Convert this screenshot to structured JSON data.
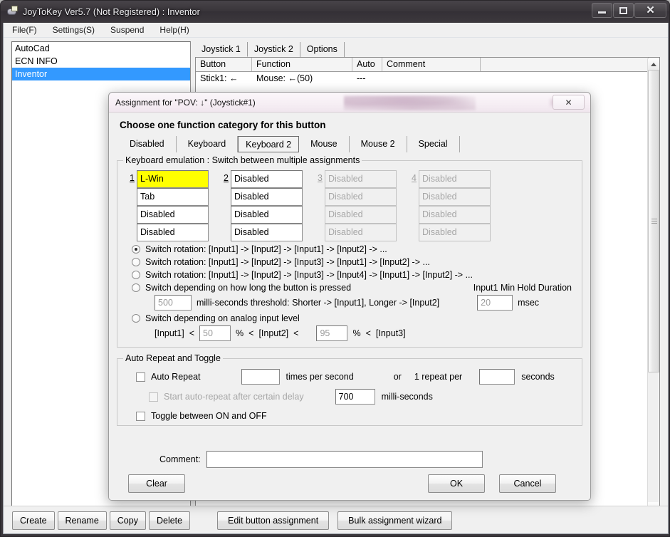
{
  "window": {
    "title": "JoyToKey Ver5.7 (Not Registered) : Inventor",
    "icon": "joystick-icon",
    "minimize_label": "Minimize",
    "maximize_label": "Maximize",
    "close_label": "✕"
  },
  "menu": {
    "items": [
      {
        "label": "File(F)"
      },
      {
        "label": "Settings(S)"
      },
      {
        "label": "Suspend"
      },
      {
        "label": "Help(H)"
      }
    ]
  },
  "profiles": {
    "items": [
      {
        "label": "AutoCad",
        "selected": false
      },
      {
        "label": "ECN INFO",
        "selected": false
      },
      {
        "label": "Inventor",
        "selected": true
      }
    ]
  },
  "tabs": [
    {
      "label": "Joystick 1",
      "active": true
    },
    {
      "label": "Joystick 2",
      "active": false
    },
    {
      "label": "Options",
      "active": false
    }
  ],
  "grid": {
    "columns": [
      "Button",
      "Function",
      "Auto",
      "Comment"
    ],
    "rows": [
      {
        "button": "Stick1: ←",
        "function": "Mouse: ←(50)",
        "auto": "---",
        "comment": ""
      }
    ]
  },
  "bottom_bar": {
    "left_buttons": [
      "Create",
      "Rename",
      "Copy",
      "Delete"
    ],
    "right_buttons": [
      "Edit button assignment",
      "Bulk assignment wizard"
    ]
  },
  "dialog": {
    "title": "Assignment for \"POV: ↓\" (Joystick#1)",
    "close_label": "✕",
    "heading": "Choose one function category for this button",
    "category_tabs": [
      {
        "label": "Disabled",
        "active": false
      },
      {
        "label": "Keyboard",
        "active": false
      },
      {
        "label": "Keyboard 2",
        "active": true
      },
      {
        "label": "Mouse",
        "active": false
      },
      {
        "label": "Mouse 2",
        "active": false
      },
      {
        "label": "Special",
        "active": false
      }
    ],
    "keyboard_group": {
      "legend": "Keyboard emulation : Switch between multiple assignments",
      "columns": [
        {
          "number": "1",
          "enabled": true,
          "fields": [
            {
              "value": "L-Win",
              "highlight": true,
              "enabled": true
            },
            {
              "value": "Tab",
              "highlight": false,
              "enabled": true
            },
            {
              "value": "Disabled",
              "highlight": false,
              "enabled": true
            },
            {
              "value": "Disabled",
              "highlight": false,
              "enabled": true
            }
          ]
        },
        {
          "number": "2",
          "enabled": true,
          "fields": [
            {
              "value": "Disabled",
              "highlight": false,
              "enabled": true
            },
            {
              "value": "Disabled",
              "highlight": false,
              "enabled": true
            },
            {
              "value": "Disabled",
              "highlight": false,
              "enabled": true
            },
            {
              "value": "Disabled",
              "highlight": false,
              "enabled": true
            }
          ]
        },
        {
          "number": "3",
          "enabled": false,
          "fields": [
            {
              "value": "Disabled",
              "highlight": false,
              "enabled": false
            },
            {
              "value": "Disabled",
              "highlight": false,
              "enabled": false
            },
            {
              "value": "Disabled",
              "highlight": false,
              "enabled": false
            },
            {
              "value": "Disabled",
              "highlight": false,
              "enabled": false
            }
          ]
        },
        {
          "number": "4",
          "enabled": false,
          "fields": [
            {
              "value": "Disabled",
              "highlight": false,
              "enabled": false
            },
            {
              "value": "Disabled",
              "highlight": false,
              "enabled": false
            },
            {
              "value": "Disabled",
              "highlight": false,
              "enabled": false
            },
            {
              "value": "Disabled",
              "highlight": false,
              "enabled": false
            }
          ]
        }
      ],
      "radios": [
        {
          "label": "Switch rotation: [Input1] -> [Input2] -> [Input1] -> [Input2] -> ...",
          "checked": true
        },
        {
          "label": "Switch rotation: [Input1] -> [Input2] -> [Input3] -> [Input1] -> [Input2] -> ...",
          "checked": false
        },
        {
          "label": "Switch rotation: [Input1] -> [Input2] -> [Input3] -> [Input4] -> [Input1] -> [Input2] -> ...",
          "checked": false
        },
        {
          "label": "Switch depending on how long the button is pressed",
          "checked": false
        },
        {
          "label": "Switch depending on analog input level",
          "checked": false
        }
      ],
      "hold": {
        "threshold_value": "500",
        "threshold_label": "milli-seconds threshold: Shorter -> [Input1], Longer -> [Input2]",
        "min_hold_label": "Input1 Min Hold Duration",
        "min_hold_value": "20",
        "msec_label": "msec"
      },
      "analog": {
        "input1_label": "[Input1]",
        "lt1": "<",
        "value1": "50",
        "pct1": "%",
        "lt2": "<",
        "input2_label": "[Input2]",
        "lt3": "<",
        "value2": "95",
        "pct2": "%",
        "lt4": "<",
        "input3_label": "[Input3]"
      }
    },
    "autorepeat_group": {
      "legend": "Auto Repeat and Toggle",
      "auto_repeat_label": "Auto Repeat",
      "auto_repeat_checked": false,
      "rate_value": "",
      "times_per_second_label": "times per second",
      "or_label": "or",
      "one_repeat_per_label": "1 repeat per",
      "seconds_value": "",
      "seconds_label": "seconds",
      "delay_label": "Start auto-repeat after certain delay",
      "delay_checked": false,
      "delay_value": "700",
      "milliseconds_label": "milli-seconds",
      "toggle_label": "Toggle between ON and OFF",
      "toggle_checked": false
    },
    "comment": {
      "label": "Comment:",
      "value": "",
      "placeholder": ""
    },
    "buttons": {
      "clear": "Clear",
      "ok": "OK",
      "cancel": "Cancel"
    }
  },
  "colors": {
    "accent": "#3399ff",
    "highlight": "#ffff00",
    "title_bar": "#383439",
    "dialog_title": "#f6eef4"
  }
}
